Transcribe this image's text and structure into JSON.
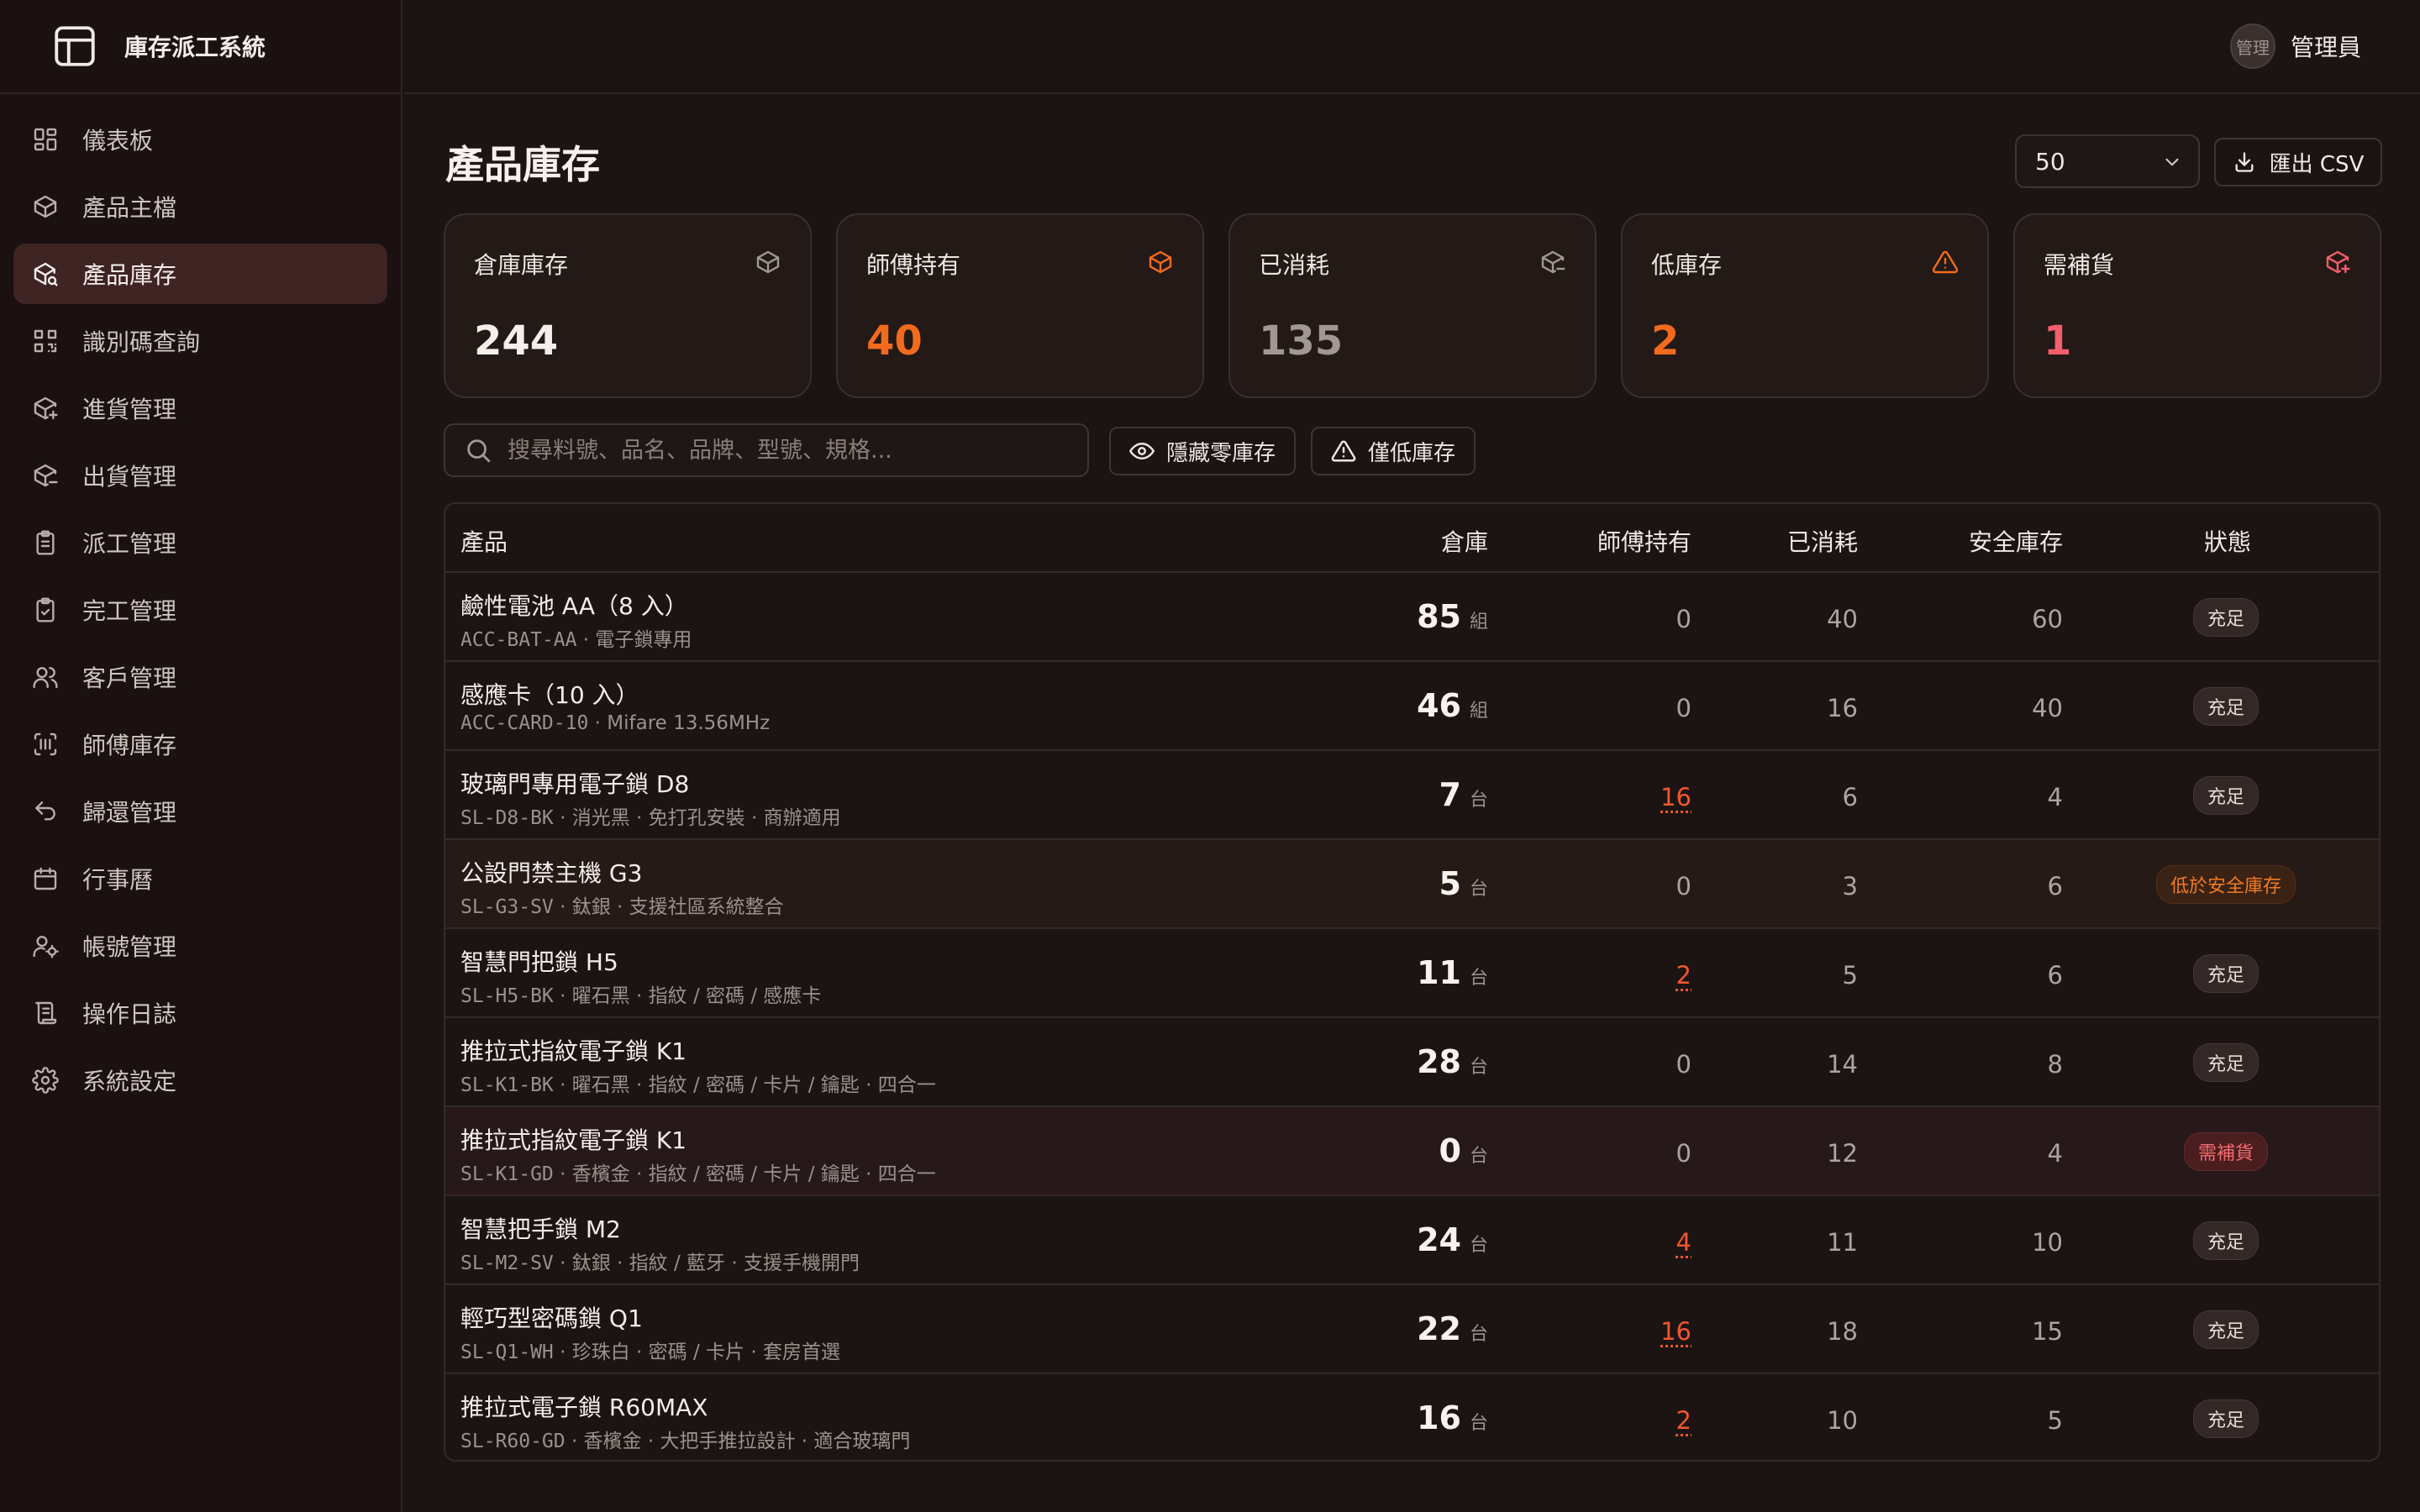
{
  "app": {
    "title": "庫存派工系統"
  },
  "colors": {
    "accent": "#f26b1d",
    "danger": "#f25f6b",
    "muted": "#a19893"
  },
  "sidebar": {
    "items": [
      {
        "label": "儀表板",
        "icon": "dashboard-icon"
      },
      {
        "label": "產品主檔",
        "icon": "box-icon"
      },
      {
        "label": "產品庫存",
        "icon": "box-search-icon",
        "active": true
      },
      {
        "label": "識別碼查詢",
        "icon": "qr-code-icon"
      },
      {
        "label": "進貨管理",
        "icon": "box-plus-icon"
      },
      {
        "label": "出貨管理",
        "icon": "box-minus-icon"
      },
      {
        "label": "派工管理",
        "icon": "clipboard-icon"
      },
      {
        "label": "完工管理",
        "icon": "clipboard-check-icon"
      },
      {
        "label": "客戶管理",
        "icon": "users-icon"
      },
      {
        "label": "師傅庫存",
        "icon": "scan-icon"
      },
      {
        "label": "歸還管理",
        "icon": "undo-icon"
      },
      {
        "label": "行事曆",
        "icon": "calendar-icon"
      },
      {
        "label": "帳號管理",
        "icon": "user-cog-icon"
      },
      {
        "label": "操作日誌",
        "icon": "scroll-icon"
      },
      {
        "label": "系統設定",
        "icon": "gear-icon"
      }
    ]
  },
  "header": {
    "avatar_text": "管理",
    "user_name": "管理員"
  },
  "page": {
    "title": "產品庫存",
    "page_size": "50",
    "export_label": "匯出 CSV"
  },
  "stats": [
    {
      "label": "倉庫庫存",
      "value": "244",
      "color": "#f5efeb",
      "icon": "box-icon"
    },
    {
      "label": "師傅持有",
      "value": "40",
      "color": "#f26b1d",
      "icon": "box-icon"
    },
    {
      "label": "已消耗",
      "value": "135",
      "color": "#a19893",
      "icon": "box-minus-icon"
    },
    {
      "label": "低庫存",
      "value": "2",
      "color": "#f26b1d",
      "icon": "warning-icon"
    },
    {
      "label": "需補貨",
      "value": "1",
      "color": "#f25f6b",
      "icon": "box-plus-icon"
    }
  ],
  "filters": {
    "search_placeholder": "搜尋料號、品名、品牌、型號、規格...",
    "hide_zero": "隱藏零庫存",
    "low_only": "僅低庫存"
  },
  "table": {
    "columns": [
      "產品",
      "倉庫",
      "師傅持有",
      "已消耗",
      "安全庫存",
      "狀態"
    ],
    "rows": [
      {
        "name": "鹼性電池 AA（8 入）",
        "sku": "ACC-BAT-AA",
        "desc": "· 電子鎖專用",
        "warehouse": "85",
        "unit": "組",
        "held": "0",
        "used": "40",
        "safety": "60",
        "status": "充足",
        "level": "ok"
      },
      {
        "name": "感應卡（10 入）",
        "sku": "ACC-CARD-10",
        "desc": "· Mifare 13.56MHz",
        "warehouse": "46",
        "unit": "組",
        "held": "0",
        "used": "16",
        "safety": "40",
        "status": "充足",
        "level": "ok"
      },
      {
        "name": "玻璃門專用電子鎖 D8",
        "sku": "SL-D8-BK",
        "desc": "· 消光黑 · 免打孔安裝 · 商辦適用",
        "warehouse": "7",
        "unit": "台",
        "held": "16",
        "used": "6",
        "safety": "4",
        "status": "充足",
        "level": "ok"
      },
      {
        "name": "公設門禁主機 G3",
        "sku": "SL-G3-SV",
        "desc": "· 鈦銀 · 支援社區系統整合",
        "warehouse": "5",
        "unit": "台",
        "held": "0",
        "used": "3",
        "safety": "6",
        "status": "低於安全庫存",
        "level": "low"
      },
      {
        "name": "智慧門把鎖 H5",
        "sku": "SL-H5-BK",
        "desc": "· 曜石黑 · 指紋 / 密碼 / 感應卡",
        "warehouse": "11",
        "unit": "台",
        "held": "2",
        "used": "5",
        "safety": "6",
        "status": "充足",
        "level": "ok"
      },
      {
        "name": "推拉式指紋電子鎖 K1",
        "sku": "SL-K1-BK",
        "desc": "· 曜石黑 · 指紋 / 密碼 / 卡片 / 鑰匙 · 四合一",
        "warehouse": "28",
        "unit": "台",
        "held": "0",
        "used": "14",
        "safety": "8",
        "status": "充足",
        "level": "ok"
      },
      {
        "name": "推拉式指紋電子鎖 K1",
        "sku": "SL-K1-GD",
        "desc": "· 香檳金 · 指紋 / 密碼 / 卡片 / 鑰匙 · 四合一",
        "warehouse": "0",
        "unit": "台",
        "held": "0",
        "used": "12",
        "safety": "4",
        "status": "需補貨",
        "level": "need"
      },
      {
        "name": "智慧把手鎖 M2",
        "sku": "SL-M2-SV",
        "desc": "· 鈦銀 · 指紋 / 藍牙 · 支援手機開門",
        "warehouse": "24",
        "unit": "台",
        "held": "4",
        "used": "11",
        "safety": "10",
        "status": "充足",
        "level": "ok"
      },
      {
        "name": "輕巧型密碼鎖 Q1",
        "sku": "SL-Q1-WH",
        "desc": "· 珍珠白 · 密碼 / 卡片 · 套房首選",
        "warehouse": "22",
        "unit": "台",
        "held": "16",
        "used": "18",
        "safety": "15",
        "status": "充足",
        "level": "ok"
      },
      {
        "name": "推拉式電子鎖 R60MAX",
        "sku": "SL-R60-GD",
        "desc": "· 香檳金 · 大把手推拉設計 · 適合玻璃門",
        "warehouse": "16",
        "unit": "台",
        "held": "2",
        "used": "10",
        "safety": "5",
        "status": "充足",
        "level": "ok"
      }
    ]
  }
}
